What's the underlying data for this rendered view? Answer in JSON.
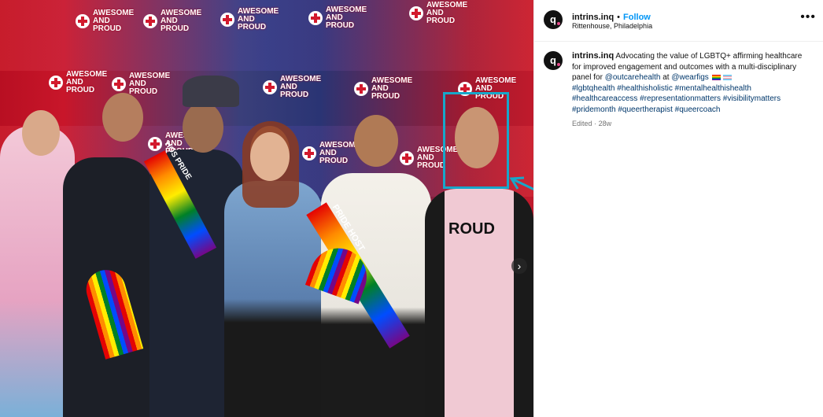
{
  "post": {
    "username": "intrins.inq",
    "separator": "•",
    "follow_label": "Follow",
    "location": "Rittenhouse, Philadelphia",
    "more_label": "•••",
    "avatar_letter": "q"
  },
  "caption": {
    "username": "intrins.inq",
    "text_before": "Advocating the value of LGBTQ+ affirming healthcare for improved engagement and outcomes with a multi-disciplinary panel for",
    "mention1": "@outcarehealth",
    "at_word": "at",
    "mention2": "@wearfigs",
    "hashtags": "#lgbtqhealth #healthisholistic #mentalhealthishealth #healthcareaccess #representationmatters #visibilitymatters #pridemonth #queertherapist #queercoach",
    "edited": "Edited",
    "dot": "·",
    "age": "28w"
  },
  "photo": {
    "backdrop_logo_line1": "AWESOME",
    "backdrop_logo_line2": "AND",
    "backdrop_logo_line3": "PROUD",
    "sash_text_1": "HOS PRIDE",
    "sash_text_2": "PRIDE HOST",
    "shirt_text": "ROUD",
    "next_icon": "›"
  },
  "colors": {
    "highlight": "#18a7c9",
    "link": "#00376b",
    "follow": "#0095f6"
  }
}
